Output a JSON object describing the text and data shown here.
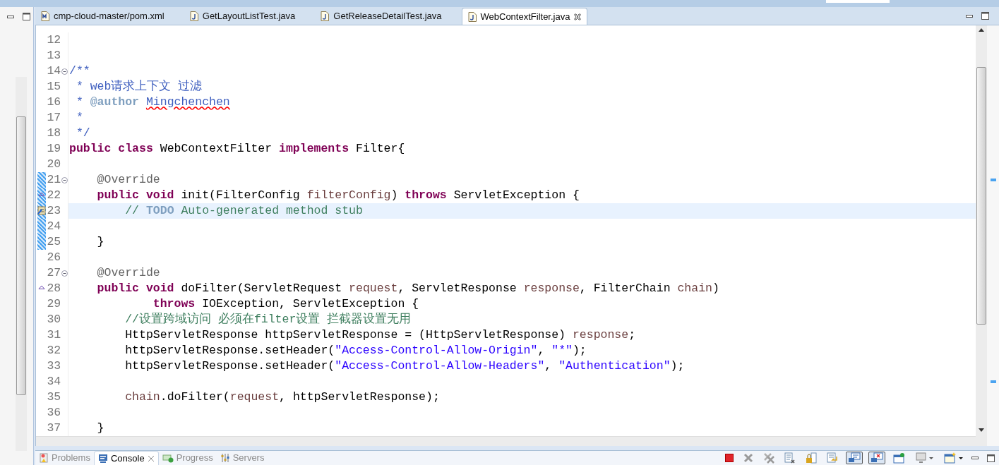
{
  "editor_tabs": [
    {
      "label": "cmp-cloud-master/pom.xml",
      "kind": "maven",
      "selected": false
    },
    {
      "label": "GetLayoutListTest.java",
      "kind": "java",
      "selected": false
    },
    {
      "label": "GetReleaseDetailTest.java",
      "kind": "java",
      "selected": false
    },
    {
      "label": "WebContextFilter.java",
      "kind": "java",
      "selected": true
    }
  ],
  "code_lines": [
    {
      "number": "12",
      "fold": false,
      "changed": false,
      "current": false
    },
    {
      "number": "13",
      "fold": false,
      "changed": false,
      "current": false
    },
    {
      "number": "14",
      "fold": true,
      "changed": false,
      "current": false,
      "tokens": [
        {
          "doc": "/**"
        }
      ]
    },
    {
      "number": "15",
      "fold": false,
      "changed": false,
      "current": false,
      "tokens": [
        {
          "doc": " * web请求上下文 过滤"
        }
      ]
    },
    {
      "number": "16",
      "fold": false,
      "changed": false,
      "current": false,
      "tokens": [
        {
          "doc": " *"
        },
        {
          "doctag": " @author "
        },
        {
          "misspelled": "Mingchenchen"
        }
      ]
    },
    {
      "number": "17",
      "fold": false,
      "changed": false,
      "current": false,
      "tokens": [
        {
          "doc": " *"
        }
      ]
    },
    {
      "number": "18",
      "fold": false,
      "changed": false,
      "current": false,
      "tokens": [
        {
          "doc": " */"
        }
      ]
    },
    {
      "number": "19",
      "fold": false,
      "changed": false,
      "current": false,
      "tokens": [
        {
          "kw": "public class"
        },
        {
          "plain": " WebContextFilter "
        },
        {
          "kw": "implements"
        },
        {
          "plain": " Filter{"
        }
      ]
    },
    {
      "number": "20",
      "fold": false,
      "changed": false,
      "current": false
    },
    {
      "number": "21",
      "fold": true,
      "changed": true,
      "current": false,
      "tokens": [
        {
          "ann": "    @Override"
        }
      ]
    },
    {
      "number": "22",
      "fold": false,
      "changed": true,
      "current": false,
      "kind": "override",
      "tokens": [
        {
          "kw": "    public void"
        },
        {
          "plain": " init(FilterConfig "
        },
        {
          "param": "filterConfig"
        },
        {
          "plain": ") "
        },
        {
          "kw": "throws"
        },
        {
          "plain": " ServletException {"
        }
      ]
    },
    {
      "number": "23",
      "fold": false,
      "changed": true,
      "current": true,
      "kind": "task",
      "tokens": [
        {
          "comment": "        //"
        },
        {
          "todo": " TODO"
        },
        {
          "comment": " Auto-generated method stub"
        }
      ]
    },
    {
      "number": "24",
      "fold": false,
      "changed": true,
      "current": false
    },
    {
      "number": "25",
      "fold": false,
      "changed": true,
      "current": false,
      "tokens": [
        {
          "plain": "    }"
        }
      ]
    },
    {
      "number": "26",
      "fold": false,
      "changed": false,
      "current": false
    },
    {
      "number": "27",
      "fold": true,
      "changed": false,
      "current": false,
      "tokens": [
        {
          "ann": "    @Override"
        }
      ]
    },
    {
      "number": "28",
      "fold": false,
      "changed": false,
      "current": false,
      "kind": "override",
      "tokens": [
        {
          "kw": "    public void"
        },
        {
          "plain": " doFilter(ServletRequest "
        },
        {
          "param": "request"
        },
        {
          "plain": ", ServletResponse "
        },
        {
          "param": "response"
        },
        {
          "plain": ", FilterChain "
        },
        {
          "param": "chain"
        },
        {
          "plain": ")"
        }
      ]
    },
    {
      "number": "29",
      "fold": false,
      "changed": false,
      "current": false,
      "tokens": [
        {
          "kw": "            throws"
        },
        {
          "plain": " IOException, ServletException {"
        }
      ]
    },
    {
      "number": "30",
      "fold": false,
      "changed": false,
      "current": false,
      "tokens": [
        {
          "comment": "        //设置跨域访问 必须在filter设置 拦截器设置无用"
        }
      ]
    },
    {
      "number": "31",
      "fold": false,
      "changed": false,
      "current": false,
      "tokens": [
        {
          "plain": "        HttpServletResponse httpServletResponse = (HttpServletResponse) "
        },
        {
          "param": "response"
        },
        {
          "plain": ";"
        }
      ]
    },
    {
      "number": "32",
      "fold": false,
      "changed": false,
      "current": false,
      "tokens": [
        {
          "plain": "        httpServletResponse.setHeader("
        },
        {
          "string": "\"Access-Control-Allow-Origin\""
        },
        {
          "plain": ", "
        },
        {
          "string": "\"*\""
        },
        {
          "plain": ");"
        }
      ]
    },
    {
      "number": "33",
      "fold": false,
      "changed": false,
      "current": false,
      "tokens": [
        {
          "plain": "        httpServletResponse.setHeader("
        },
        {
          "string": "\"Access-Control-Allow-Headers\""
        },
        {
          "plain": ", "
        },
        {
          "string": "\"Authentication\""
        },
        {
          "plain": ");"
        }
      ]
    },
    {
      "number": "34",
      "fold": false,
      "changed": false,
      "current": false
    },
    {
      "number": "35",
      "fold": false,
      "changed": false,
      "current": false,
      "tokens": [
        {
          "param": "        chain"
        },
        {
          "plain": ".doFilter("
        },
        {
          "param": "request"
        },
        {
          "plain": ", httpServletResponse);"
        }
      ]
    },
    {
      "number": "36",
      "fold": false,
      "changed": false,
      "current": false
    },
    {
      "number": "37",
      "fold": false,
      "changed": false,
      "current": false,
      "tokens": [
        {
          "plain": "    }"
        }
      ]
    }
  ],
  "bottom_tabs": [
    {
      "label": "Problems",
      "kind": "problems",
      "selected": false
    },
    {
      "label": "Console",
      "kind": "console",
      "selected": true
    },
    {
      "label": "Progress",
      "kind": "progress",
      "selected": false
    },
    {
      "label": "Servers",
      "kind": "servers",
      "selected": false
    }
  ],
  "console_toolbar": [
    {
      "kind": "terminate",
      "pressed": false
    },
    {
      "kind": "remove",
      "pressed": false
    },
    {
      "kind": "remove-all",
      "pressed": false
    },
    {
      "kind": "clear",
      "pressed": false
    },
    {
      "kind": "scroll-lock",
      "pressed": false
    },
    {
      "kind": "word-wrap",
      "pressed": false
    },
    {
      "kind": "show-stdout",
      "pressed": true
    },
    {
      "kind": "show-stderr",
      "pressed": true
    },
    {
      "kind": "pin",
      "pressed": false
    },
    {
      "kind": "display",
      "pressed": false
    },
    {
      "kind": "new-console",
      "pressed": false
    }
  ]
}
